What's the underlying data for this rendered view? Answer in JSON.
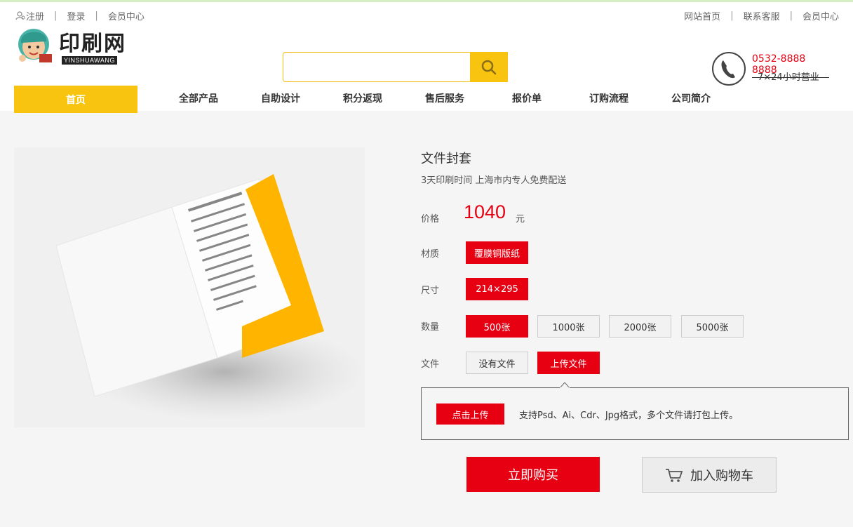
{
  "topbar": {
    "register": "注册",
    "login": "登录",
    "member_center": "会员中心",
    "separator": "|",
    "site_home": "网站首页",
    "contact": "联系客服",
    "member_center_right": "会员中心"
  },
  "logo": {
    "title": "印刷网",
    "subtitle": "YINSHUAWANG"
  },
  "search": {
    "value": "",
    "placeholder": ""
  },
  "phone": {
    "number": "0532-8888 8888",
    "hours": "7×24小时营业"
  },
  "nav": {
    "home": "首页",
    "items": [
      "全部产品",
      "自助设计",
      "积分返现",
      "售后服务",
      "报价单",
      "订购流程",
      "公司简介"
    ]
  },
  "product": {
    "title": "文件封套",
    "subtitle": "3天印刷时间 上海市内专人免费配送",
    "price_label": "价格",
    "price": "1040",
    "currency": "元",
    "material_label": "材质",
    "material": "覆膜铜版纸",
    "size_label": "尺寸",
    "size": "214×295",
    "qty_label": "数量",
    "quantities": [
      "500张",
      "1000张",
      "2000张",
      "5000张"
    ],
    "file_label": "文件",
    "file_options": [
      "没有文件",
      "上传文件"
    ],
    "upload_button": "点击上传",
    "upload_hint": "支持Psd、Ai、Cdr、Jpg格式，多个文件请打包上传。",
    "buy_now": "立即购买",
    "add_cart": "加入购物车"
  },
  "colors": {
    "accent_yellow": "#f8c410",
    "accent_red": "#e60012"
  },
  "icons": [
    "user-icon",
    "search-icon",
    "phone-icon",
    "cart-icon"
  ]
}
